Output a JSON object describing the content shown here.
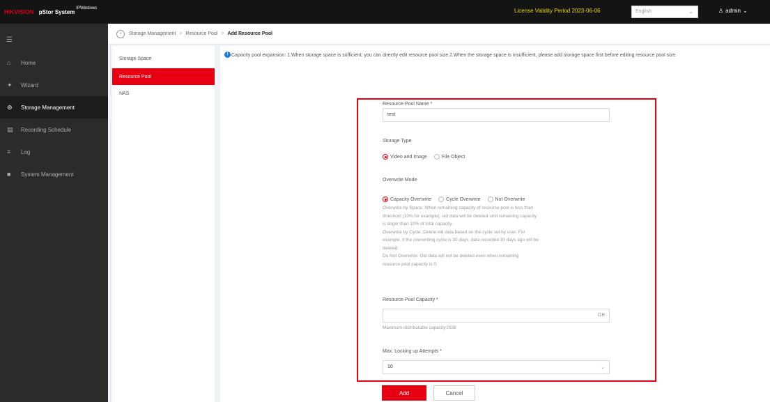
{
  "header": {
    "brand_logo": "HIKVISION",
    "brand_sub": "",
    "product": "pStor System",
    "edition": "IPWindows",
    "license": "License Validity Period 2023-06-06",
    "language": "English",
    "user": "admin"
  },
  "sidebar": {
    "items": [
      {
        "label": "Home",
        "icon": "home-icon"
      },
      {
        "label": "Wizard",
        "icon": "wizard-icon"
      },
      {
        "label": "Storage Management",
        "icon": "storage-icon"
      },
      {
        "label": "Recording Schedule",
        "icon": "schedule-icon"
      },
      {
        "label": "Log",
        "icon": "log-icon"
      },
      {
        "label": "System Management",
        "icon": "system-icon"
      }
    ]
  },
  "breadcrumb": {
    "items": [
      "Storage Management",
      "Resource Pool",
      "Add Resource Pool"
    ]
  },
  "submenu": {
    "items": [
      "Storage Space",
      "Resource Pool",
      "NAS"
    ]
  },
  "info": {
    "text": "Capacity pool expansion: 1.When storage space is sufficient, you can directly edit resource pool size.2.When the storage space is insufficient, please add storage space first before editing resource pool size."
  },
  "form": {
    "name_label": "Resource Pool Name *",
    "name_value": "test",
    "storage_type_label": "Storage Type",
    "storage_types": [
      "Video and Image",
      "File Object"
    ],
    "overwrite_label": "Overwrite Mode",
    "overwrite_modes": [
      "Capacity Overwrite",
      "Cycle Overwrite",
      "Not Overwrite"
    ],
    "overwrite_desc": [
      "Overwrite by Space: When remaining capacity of resource pool is less than",
      "threshold (10% for example), old data will be deleted until remaining capacity",
      "is larger than 10% of total capacity.",
      "Overwrite by Cycle: Delete old data based on the cycle set by user. For",
      "example, if the overwriting cycle is 30 days, data recorded 30 days ago will be",
      "deleted.",
      "Do Not Overwrite: Old data will not be deleted even when remaining",
      "resource pool capacity is 0."
    ],
    "capacity_label": "Resource Pool Capacity *",
    "capacity_value": "",
    "capacity_unit": "GB",
    "capacity_hint": "Maximum distributable capacity:0GB",
    "lockup_label": "Max. Locking up Attempts *",
    "lockup_value": "10"
  },
  "buttons": {
    "add": "Add",
    "cancel": "Cancel"
  },
  "colors": {
    "accent": "#e60012",
    "license": "#e6d800",
    "sidebar": "#2b2b2b"
  }
}
